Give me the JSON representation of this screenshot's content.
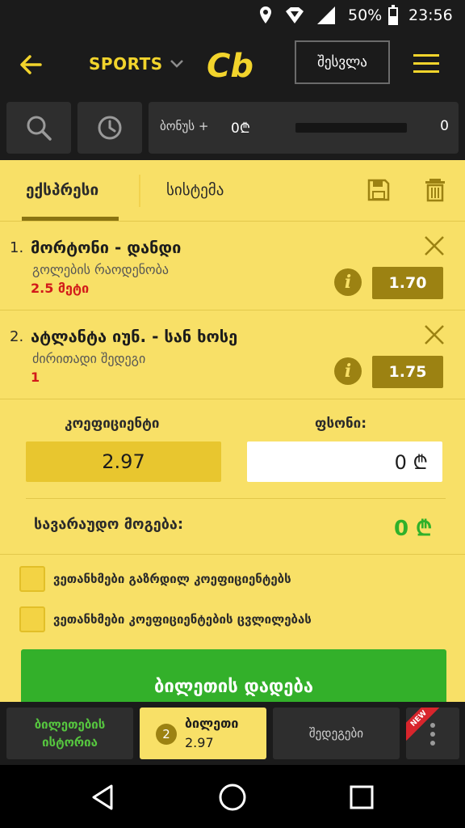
{
  "status_bar": {
    "battery_pct": "50%",
    "time": "23:56"
  },
  "app_bar": {
    "sports_label": "SPORTS",
    "logo_text": "Cb",
    "login_label": "შესვლა"
  },
  "search_row": {
    "bonus_label": "ბონუს +",
    "bonus_value": "0₾",
    "bonus_count": "0"
  },
  "slip": {
    "tabs": [
      "ექსპრესი",
      "სისტემა"
    ],
    "bets": [
      {
        "num": "1.",
        "title": "მორტონი - დანდი",
        "market": "გოლების რაოდენობა",
        "pick": "2.5 მეტი",
        "odd": "1.70"
      },
      {
        "num": "2.",
        "title": "ატლანტა იუნ. - სან ხოსე",
        "market": "ძირითადი შედეგი",
        "pick": "1",
        "odd": "1.75"
      }
    ],
    "coef_label": "კოეფიციენტი",
    "coef_value": "2.97",
    "stake_label": "ფსონი:",
    "stake_value": "0 ₾",
    "potential_win_label": "სავარაუდო მოგება:",
    "potential_win_value": "0 ₾",
    "checkboxes": [
      "ვეთანხმები გაზრდილ კოეფიციენტებს",
      "ვეთანხმები კოეფიციენტების ცვლილებას"
    ],
    "place_bet_label": "ბილეთის დადება"
  },
  "bottom_bar": {
    "history_line1": "ბილეთების",
    "history_line2": "ისტორია",
    "slip_count": "2",
    "slip_label": "ბილეთი",
    "slip_odds": "2.97",
    "results_label": "შედეგები",
    "new_badge": "NEW"
  },
  "colors": {
    "accent_yellow": "#f8e067",
    "odds_gold": "#9c8212",
    "win_green": "#2fb12a",
    "pick_red": "#d21a1a",
    "dark_bg": "#1b1b1b"
  }
}
